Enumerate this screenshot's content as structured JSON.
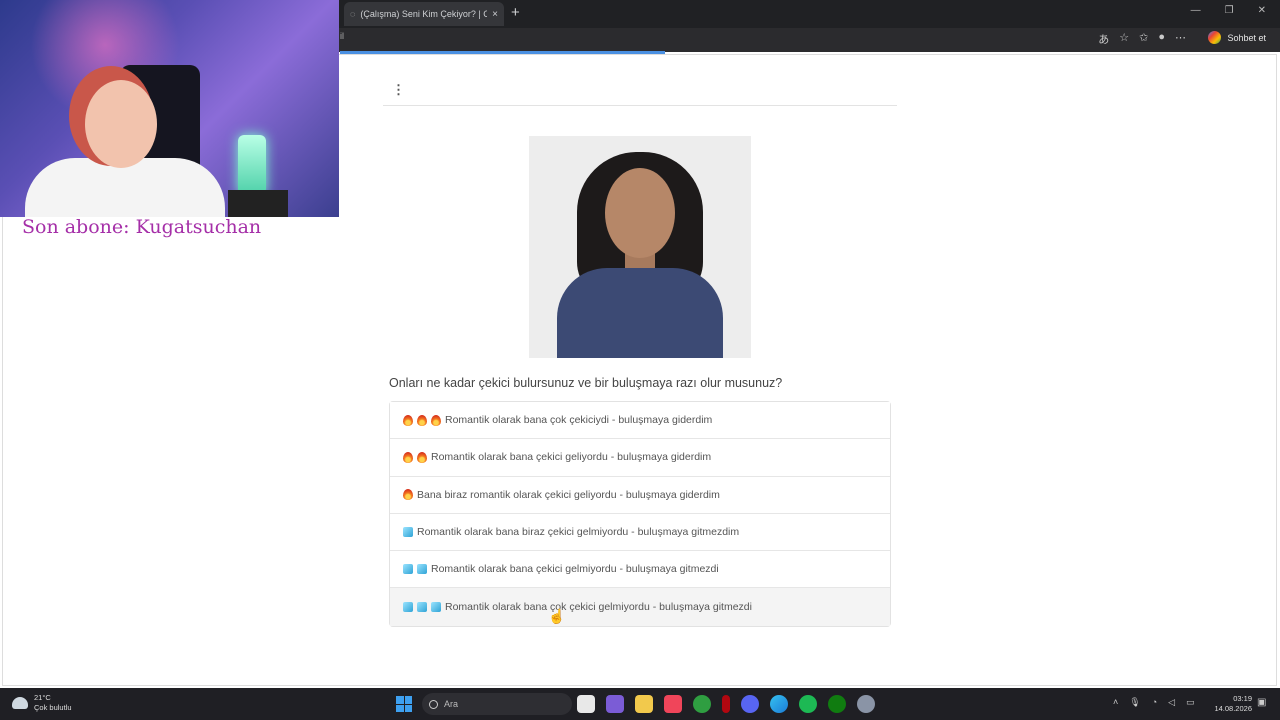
{
  "browser": {
    "tab_title": "(Çalışma) Seni Kim Çekiyor? | Clea",
    "tab_close": "×",
    "new_tab": "+",
    "window_controls": [
      "—",
      "❐",
      "✕"
    ],
    "address_fragment": "il",
    "chat_button_label": "Sohbet et",
    "accent_color": "#4a90e2"
  },
  "stream_overlay": {
    "subscriber_text": "Son abone: Kugatsuchan",
    "subscriber_color": "#a52fa8"
  },
  "form": {
    "menu_icon": "⋮",
    "question": "Onları ne kadar çekici bulursunuz ve bir buluşmaya razı olur musunuz?",
    "options": [
      {
        "emoji": "fire",
        "count": 3,
        "label": "Romantik olarak bana çok çekiciydi - buluşmaya giderdim"
      },
      {
        "emoji": "fire",
        "count": 2,
        "label": "Romantik olarak bana çekici geliyordu - buluşmaya giderdim"
      },
      {
        "emoji": "fire",
        "count": 1,
        "label": "Bana biraz romantik olarak çekici geliyordu - buluşmaya giderdim"
      },
      {
        "emoji": "ice",
        "count": 1,
        "label": "Romantik olarak bana biraz çekici gelmiyordu - buluşmaya gitmezdim"
      },
      {
        "emoji": "ice",
        "count": 2,
        "label": "Romantik olarak bana çekici gelmiyordu - buluşmaya gitmezdi"
      },
      {
        "emoji": "ice",
        "count": 3,
        "label": "Romantik olarak bana çok çekici gelmiyordu - buluşmaya gitmezdi"
      }
    ]
  },
  "taskbar": {
    "weather_temp": "21°C",
    "weather_desc": "Çok bulutlu",
    "search_placeholder": "Ara",
    "time": "03:19",
    "date": "14.08.2026"
  }
}
